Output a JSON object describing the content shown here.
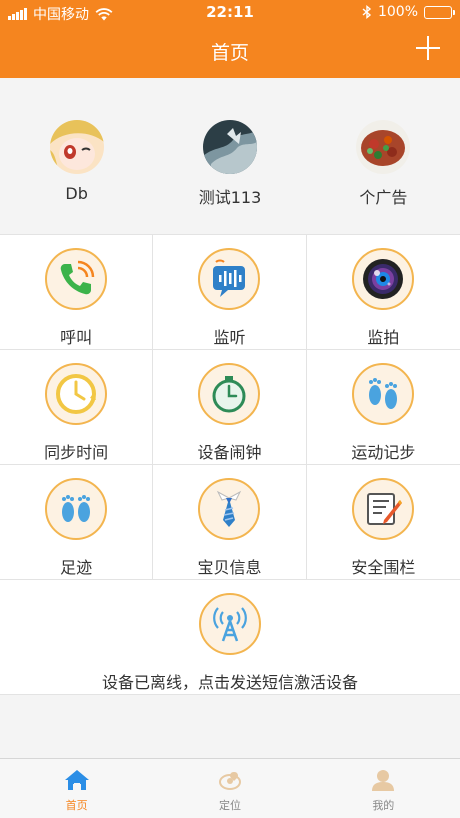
{
  "status_bar": {
    "carrier": "中国移动",
    "time": "22:11",
    "battery": "100%"
  },
  "nav": {
    "title": "首页"
  },
  "devices": [
    {
      "name": "Db"
    },
    {
      "name": "测试113"
    },
    {
      "name": "个广告"
    }
  ],
  "functions": [
    {
      "label": "呼叫",
      "icon": "phone-call-icon"
    },
    {
      "label": "监听",
      "icon": "listen-voice-icon"
    },
    {
      "label": "监拍",
      "icon": "camera-lens-icon"
    },
    {
      "label": "同步时间",
      "icon": "sync-clock-icon"
    },
    {
      "label": "设备闹钟",
      "icon": "alarm-clock-icon"
    },
    {
      "label": "运动记步",
      "icon": "footsteps-icon"
    },
    {
      "label": "足迹",
      "icon": "footprints-icon"
    },
    {
      "label": "宝贝信息",
      "icon": "tie-info-icon"
    },
    {
      "label": "安全围栏",
      "icon": "notepad-pen-icon"
    }
  ],
  "activate": {
    "label": "设备已离线，点击发送短信激活设备",
    "icon": "antenna-icon"
  },
  "tabbar": [
    {
      "label": "首页",
      "active": true
    },
    {
      "label": "定位",
      "active": false
    },
    {
      "label": "我的",
      "active": false
    }
  ],
  "colors": {
    "brand": "#f5851f",
    "icon_border": "#f3b54f",
    "icon_bg": "#fdf2e3"
  }
}
